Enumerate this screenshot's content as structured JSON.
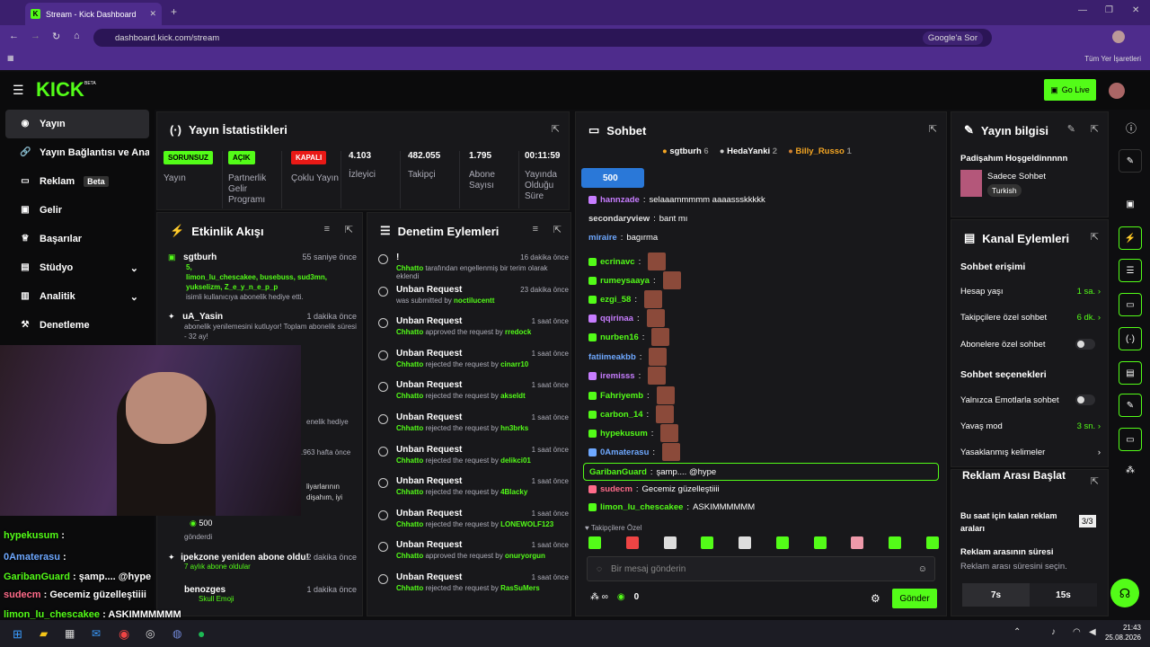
{
  "browser": {
    "tab_title": "Stream - Kick Dashboard",
    "url": "dashboard.kick.com/stream",
    "google_btn": "Google'a Sor",
    "bookmarks": "Tüm Yer İşaretleri"
  },
  "topnav": {
    "logo": "KICK",
    "beta": "BETA",
    "go_live": "Go Live"
  },
  "sidebar": {
    "items": [
      {
        "label": "Yayın",
        "icon": "broadcast-icon"
      },
      {
        "label": "Yayın Bağlantısı ve Anahtarı",
        "icon": "link-icon"
      },
      {
        "label": "Reklam",
        "icon": "ad-icon",
        "badge": "Beta"
      },
      {
        "label": "Gelir",
        "icon": "wallet-icon"
      },
      {
        "label": "Başarılar",
        "icon": "trophy-icon"
      },
      {
        "label": "Stüdyo",
        "icon": "studio-icon"
      },
      {
        "label": "Analitik",
        "icon": "analytics-icon"
      },
      {
        "label": "Denetleme",
        "icon": "hammer-icon"
      }
    ]
  },
  "stats": {
    "title": "Yayın İstatistikleri",
    "items": [
      {
        "badge": "SORUNSUZ",
        "label": "Yayın"
      },
      {
        "badge": "AÇIK",
        "label": "Partnerlik Gelir Programı"
      },
      {
        "badge": "KAPALI",
        "label": "Çoklu Yayın"
      },
      {
        "value": "4.103",
        "label": "İzleyici"
      },
      {
        "value": "482.055",
        "label": "Takipçi"
      },
      {
        "value": "1.795",
        "label": "Abone Sayısı"
      },
      {
        "value": "00:11:59",
        "label": "Yayında Olduğu Süre"
      }
    ]
  },
  "activity": {
    "title": "Etkinlik Akışı",
    "items": [
      {
        "name": "sgtburh",
        "time": "55 saniye önce",
        "line1": "5,",
        "line2": "limon_lu_chescakee, busebuss, sud3mn,",
        "line3": "yukselizm, Z_e_y_n_e_p_p",
        "line4": "isimli kullanıcıya abonelik hediye etti."
      },
      {
        "name": "uA_Yasin",
        "time": "1 dakika önce",
        "line1": "abonelik yenilemesini kutluyor! Toplam abonelik süresi - 32 ay!"
      },
      {
        "name": "ipekzone yeniden abone oldu!",
        "time": "2 dakika önce",
        "line1": "7 aylık abone oldular"
      },
      {
        "name": "benozges",
        "time": "1 dakika önce",
        "line1": "Skull Emoji"
      }
    ],
    "partial": {
      "t1": "enelik hediye",
      "t2": ".963 hafta önce",
      "t3": "liyarlarının",
      "t4": "dişahım, iyi",
      "amount": "500",
      "sent": "gönderdi"
    }
  },
  "moderation": {
    "title": "Denetim Eylemleri",
    "items": [
      {
        "title": "!",
        "time": "16 dakika önce",
        "actor": "Chhatto",
        "text": "tarafından engellenmiş bir terim olarak eklendi",
        "target": ""
      },
      {
        "title": "Unban Request",
        "time": "23 dakika önce",
        "actor": "",
        "text": "was submitted by",
        "target": "noctilucentt"
      },
      {
        "title": "Unban Request",
        "time": "1 saat önce",
        "actor": "Chhatto",
        "text": "approved the request by",
        "target": "rredock"
      },
      {
        "title": "Unban Request",
        "time": "1 saat önce",
        "actor": "Chhatto",
        "text": "rejected the request by",
        "target": "cinarr10"
      },
      {
        "title": "Unban Request",
        "time": "1 saat önce",
        "actor": "Chhatto",
        "text": "rejected the request by",
        "target": "akseldt"
      },
      {
        "title": "Unban Request",
        "time": "1 saat önce",
        "actor": "Chhatto",
        "text": "rejected the request by",
        "target": "hn3brks"
      },
      {
        "title": "Unban Request",
        "time": "1 saat önce",
        "actor": "Chhatto",
        "text": "rejected the request by",
        "target": "delikci01"
      },
      {
        "title": "Unban Request",
        "time": "1 saat önce",
        "actor": "Chhatto",
        "text": "rejected the request by",
        "target": "4Blacky"
      },
      {
        "title": "Unban Request",
        "time": "1 saat önce",
        "actor": "Chhatto",
        "text": "rejected the request by",
        "target": "LONEWOLF123"
      },
      {
        "title": "Unban Request",
        "time": "1 saat önce",
        "actor": "Chhatto",
        "text": "approved the request by",
        "target": "onuryorgun"
      },
      {
        "title": "Unban Request",
        "time": "1 saat önce",
        "actor": "Chhatto",
        "text": "rejected the request by",
        "target": "RasSuMers"
      }
    ]
  },
  "chat": {
    "title": "Sohbet",
    "top_gifters": [
      {
        "name": "sgtburh",
        "count": "6"
      },
      {
        "name": "HedaYanki",
        "count": "2"
      },
      {
        "name": "Billy_Russo",
        "count": "1"
      }
    ],
    "pinned_amount": "500",
    "messages": [
      {
        "user": "hannzade",
        "color": "#c77dff",
        "text": "selaaammmmm aaaassskkkkk"
      },
      {
        "user": "secondaryview",
        "color": "#e0e0e0",
        "text": "bant mı"
      },
      {
        "user": "miraire",
        "color": "#6ea8ff",
        "text": "bagırma"
      },
      {
        "user": "ecrinavc",
        "color": "#53fc18",
        "text": ""
      },
      {
        "user": "rumeysaaya",
        "color": "#53fc18",
        "text": ""
      },
      {
        "user": "ezgi_58",
        "color": "#53fc18",
        "text": ""
      },
      {
        "user": "qqirinaa",
        "color": "#c77dff",
        "text": ""
      },
      {
        "user": "nurben16",
        "color": "#53fc18",
        "text": ""
      },
      {
        "user": "fatiimeakbb",
        "color": "#6ea8ff",
        "text": ""
      },
      {
        "user": "iremisss",
        "color": "#c77dff",
        "text": ""
      },
      {
        "user": "Fahriyemb",
        "color": "#53fc18",
        "text": ""
      },
      {
        "user": "carbon_14",
        "color": "#53fc18",
        "text": ""
      },
      {
        "user": "hypekusum",
        "color": "#53fc18",
        "text": ""
      },
      {
        "user": "0Amaterasu",
        "color": "#6ea8ff",
        "text": ""
      },
      {
        "user": "GaribanGuard",
        "color": "#53fc18",
        "text": "şamp.... @hype"
      },
      {
        "user": "sudecm",
        "color": "#ff6b8a",
        "text": "Gecemiz güzelleştiiii"
      },
      {
        "user": "limon_lu_chescakee",
        "color": "#53fc18",
        "text": "ASKIMMMMMM"
      }
    ],
    "followers_only": "Takipçilere Özel",
    "input_placeholder": "Bir mesaj gönderin",
    "points": "0",
    "send_label": "Gönder"
  },
  "stream_info": {
    "title": "Yayın bilgisi",
    "stream_title": "Padişahım Hoşgeldinnnnn",
    "category": "Sadece Sohbet",
    "language": "Turkish"
  },
  "channel_actions": {
    "title": "Kanal Eylemleri",
    "chat_access": "Sohbet erişimi",
    "account_age": {
      "label": "Hesap yaşı",
      "value": "1 sa."
    },
    "followers_only": {
      "label": "Takipçilere özel sohbet",
      "value": "6 dk."
    },
    "subs_only": {
      "label": "Abonelere özel sohbet"
    },
    "chat_options": "Sohbet seçenekleri",
    "emote_only": {
      "label": "Yalnızca Emotlarla sohbet"
    },
    "slow_mode": {
      "label": "Yavaş mod",
      "value": "3 sn."
    },
    "banned_words": {
      "label": "Yasaklanmış kelimeler"
    }
  },
  "ad_break": {
    "title": "Reklam Arası Başlat",
    "remaining_label": "Bu saat için kalan reklam araları",
    "remaining_value": "3/3",
    "duration_label": "Reklam arasının süresi",
    "duration_hint": "Reklam arası süresini seçin.",
    "options": [
      "7s",
      "15s"
    ]
  },
  "webcam_overlay": {
    "lines": [
      {
        "user": "hypekusum",
        "color": "#53fc18",
        "text": ":"
      },
      {
        "user": "0Amaterasu",
        "color": "#6ea8ff",
        "text": ":"
      },
      {
        "user": "GaribanGuard",
        "color": "#53fc18",
        "text": ": şamp.... @hype"
      },
      {
        "user": "sudecm",
        "color": "#ff6b8a",
        "text": ": Gecemiz güzelleştiiii"
      },
      {
        "user": "limon_lu_chescakee",
        "color": "#53fc18",
        "text": ": ASKIMMMMMM"
      }
    ]
  },
  "taskbar": {
    "time": "21:43",
    "date": "25.08.2026"
  },
  "colors": {
    "accent": "#53fc18",
    "panel": "#18181b",
    "bg": "#0e0e10"
  }
}
